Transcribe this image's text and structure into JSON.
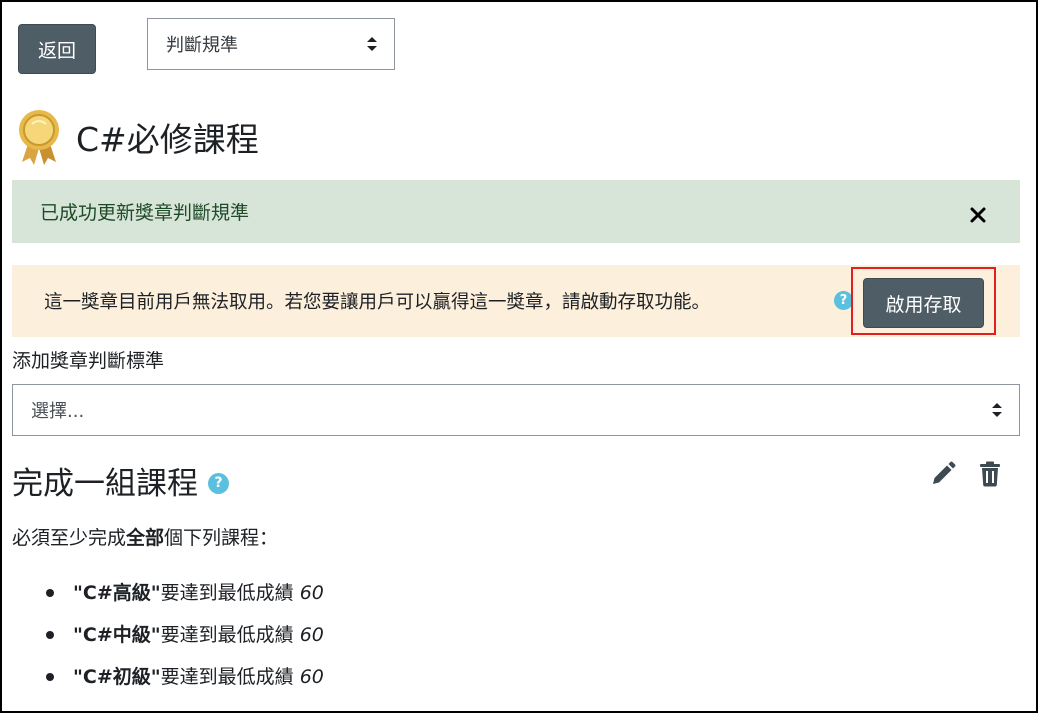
{
  "header": {
    "back_label": "返回",
    "nav_select_value": "判斷規準"
  },
  "badge": {
    "title": "C#必修課程"
  },
  "alerts": {
    "success_text": "已成功更新獎章判斷規準",
    "warning_text": "這一獎章目前用戶無法取用。若您要讓用戶可以贏得這一獎章，請啟動存取功能。",
    "enable_button_label": "啟用存取"
  },
  "criteria": {
    "add_label": "添加獎章判斷標準",
    "select_placeholder": "選擇..."
  },
  "section": {
    "title": "完成一組課程",
    "desc_prefix": "必須至少完成",
    "desc_bold": "全部",
    "desc_suffix": "個下列課程：",
    "courses": [
      {
        "name": "\"C#高級\"",
        "requirement": "要達到最低成績",
        "grade": "60"
      },
      {
        "name": "\"C#中級\"",
        "requirement": "要達到最低成績",
        "grade": "60"
      },
      {
        "name": "\"C#初級\"",
        "requirement": "要達到最低成績",
        "grade": "60"
      }
    ]
  },
  "colors": {
    "button_bg": "#4f5d66",
    "success_bg": "#d7e4d8",
    "warning_bg": "#fcefdc",
    "help_icon": "#5bc0de",
    "highlight": "#e02020"
  },
  "icons": [
    "medal-icon",
    "close-icon",
    "help-icon",
    "select-arrows-icon",
    "edit-icon",
    "trash-icon"
  ]
}
